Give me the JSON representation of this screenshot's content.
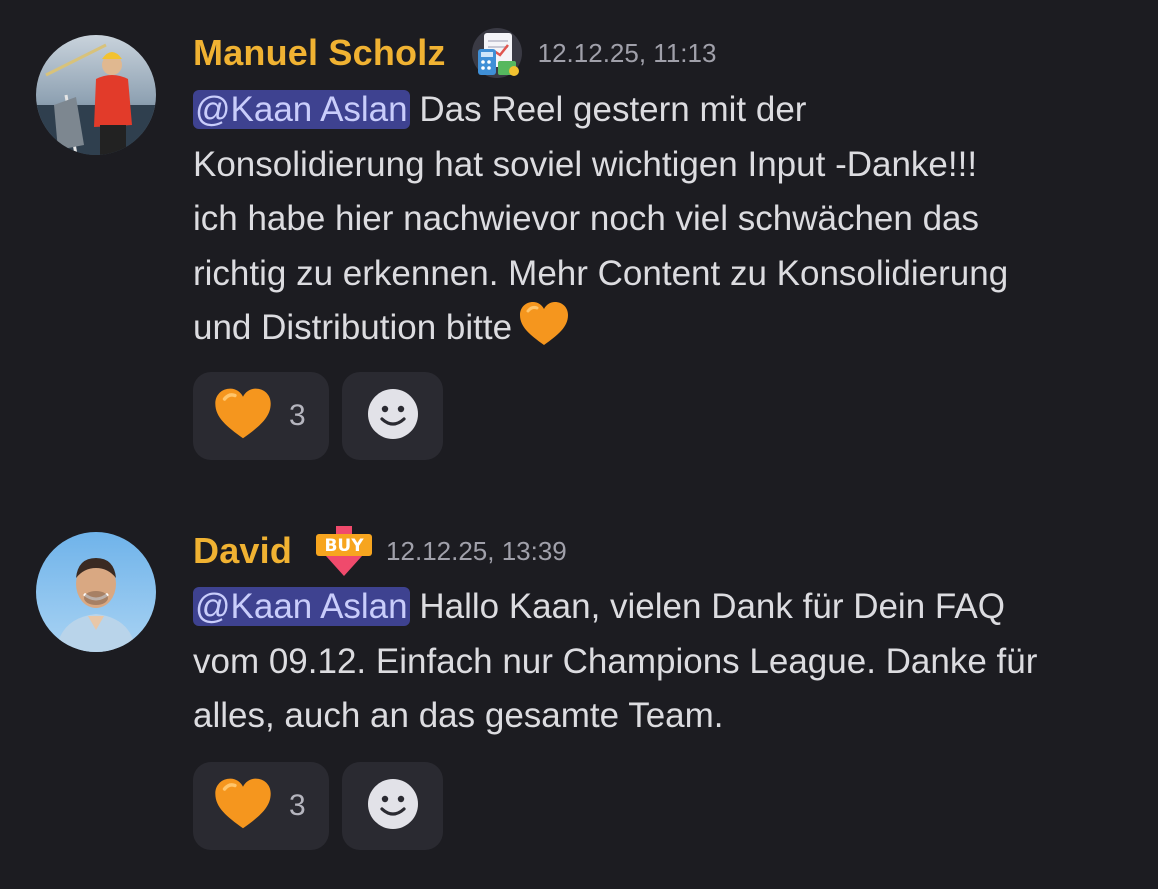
{
  "messages": [
    {
      "author": "Manuel Scholz",
      "badge_icon": "spreadsheet-calculator-icon",
      "timestamp": "12.12.25, 11:13",
      "mention": "@Kaan Aslan",
      "lines": [
        " Das Reel gestern mit der",
        "Konsolidierung hat soviel wichtigen Input -Danke!!!",
        "ich habe hier nachwievor noch viel schwächen das",
        "richtig zu erkennen. Mehr Content zu Konsolidierung",
        "und Distribution bitte"
      ],
      "trailing_icon": "orange-heart-icon",
      "reactions": [
        {
          "icon": "orange-heart-icon",
          "count": "3"
        }
      ],
      "add_reaction_icon": "smiley-icon"
    },
    {
      "author": "David",
      "badge_icon": "buy-arrow-icon",
      "badge_text": "BUY",
      "timestamp": "12.12.25, 13:39",
      "mention": "@Kaan Aslan",
      "lines": [
        " Hallo Kaan, vielen Dank für Dein FAQ",
        "vom 09.12. Einfach nur Champions League. Danke für",
        "alles, auch an das gesamte Team."
      ],
      "reactions": [
        {
          "icon": "orange-heart-icon",
          "count": "3"
        }
      ],
      "add_reaction_icon": "smiley-icon"
    }
  ],
  "colors": {
    "background": "#1c1c21",
    "username": "#f0b232",
    "mention_bg": "#3e4290",
    "mention_text": "#c9cdfb",
    "reaction_bg": "#2a2a31",
    "heart": "#f5961e"
  }
}
